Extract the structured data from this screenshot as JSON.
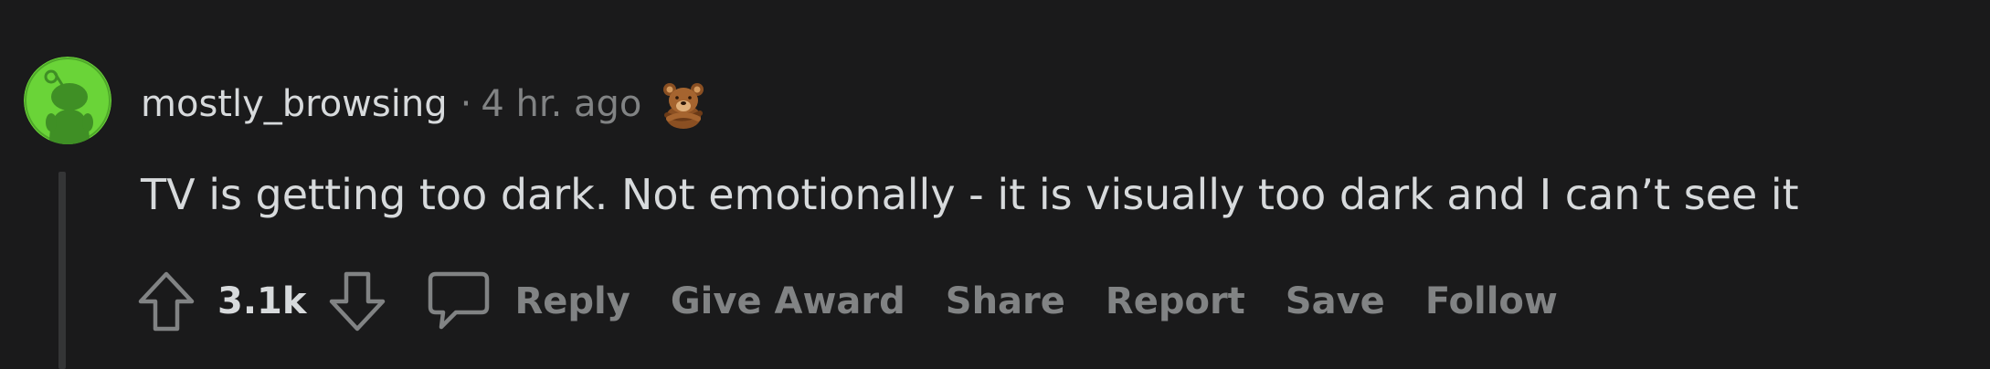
{
  "comment": {
    "username": "mostly_browsing",
    "separator": "·",
    "timestamp": "4 hr. ago",
    "body": "TV is getting too dark. Not emotionally - it is visually too dark and I can’t see it",
    "score": "3.1k",
    "award_icon": "bear-award-icon",
    "avatar_icon": "snoo-avatar-icon"
  },
  "actions": {
    "reply": "Reply",
    "give_award": "Give Award",
    "share": "Share",
    "report": "Report",
    "save": "Save",
    "follow": "Follow"
  },
  "colors": {
    "background": "#1a1a1b",
    "text_primary": "#d7dadc",
    "text_muted": "#818384",
    "avatar_bg": "#6ad438",
    "thread_line": "#343536"
  }
}
